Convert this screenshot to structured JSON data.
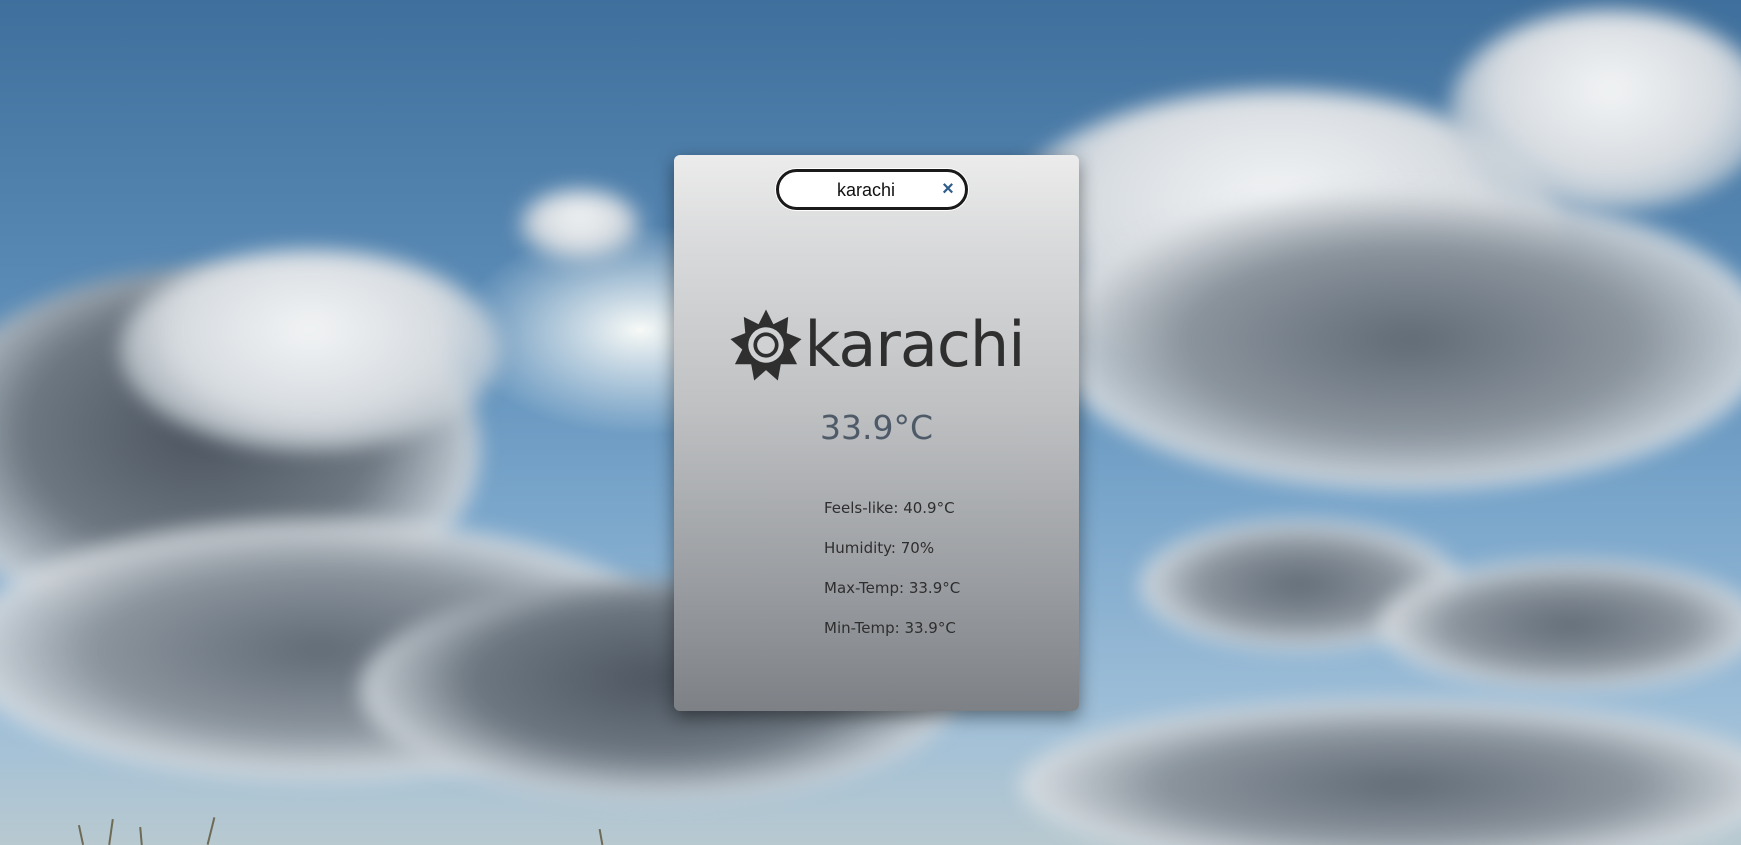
{
  "search": {
    "value": "karachi",
    "clear_glyph": "×",
    "clear_icon": "close-icon"
  },
  "weather": {
    "icon": "sun-icon",
    "city": "karachi",
    "temperature": "33.9°C",
    "details": [
      {
        "label": "Feels-like: 40.9°C"
      },
      {
        "label": "Humidity: 70%"
      },
      {
        "label": "Max-Temp: 33.9°C"
      },
      {
        "label": "Min-Temp: 33.9°C"
      }
    ]
  },
  "colors": {
    "clear_icon": "#2f5d8a",
    "temperature": "#4f5a69",
    "city": "#2f2f2f"
  }
}
